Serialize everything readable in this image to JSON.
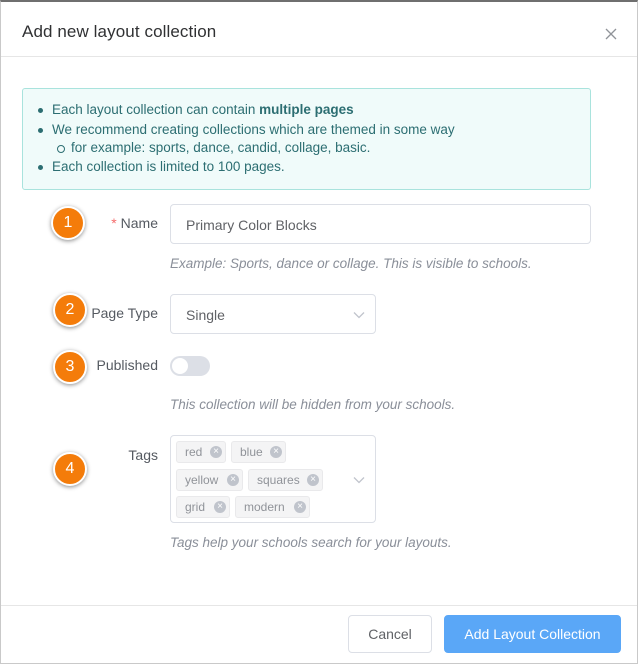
{
  "dialog": {
    "title": "Add new layout collection",
    "close_icon": "close-icon"
  },
  "info": {
    "line1_prefix": "Each layout collection can contain ",
    "line1_bold": "multiple pages",
    "line2": "We recommend creating collections which are themed in some way",
    "line3": "for example: sports, dance, candid, collage, basic.",
    "line4": "Each collection is limited to 100 pages."
  },
  "steps": [
    "1",
    "2",
    "3",
    "4"
  ],
  "form": {
    "name": {
      "required_mark": "*",
      "label": "Name",
      "value": "Primary Color Blocks",
      "hint": "Example: Sports, dance or collage. This is visible to schools."
    },
    "page_type": {
      "label": "Page Type",
      "value": "Single"
    },
    "published": {
      "label": "Published",
      "on": false,
      "hint": "This collection will be hidden from your schools."
    },
    "tags": {
      "label": "Tags",
      "items": [
        "red",
        "blue",
        "yellow",
        "squares",
        "grid",
        "modern"
      ],
      "hint": "Tags help your schools search for your layouts."
    }
  },
  "footer": {
    "cancel_label": "Cancel",
    "submit_label": "Add Layout Collection"
  },
  "colors": {
    "accent": "#5aa7f7",
    "badge": "#f47c0a",
    "info_text": "#2c6e72",
    "info_bg": "#f0fbfa",
    "required": "#f56c6c"
  }
}
